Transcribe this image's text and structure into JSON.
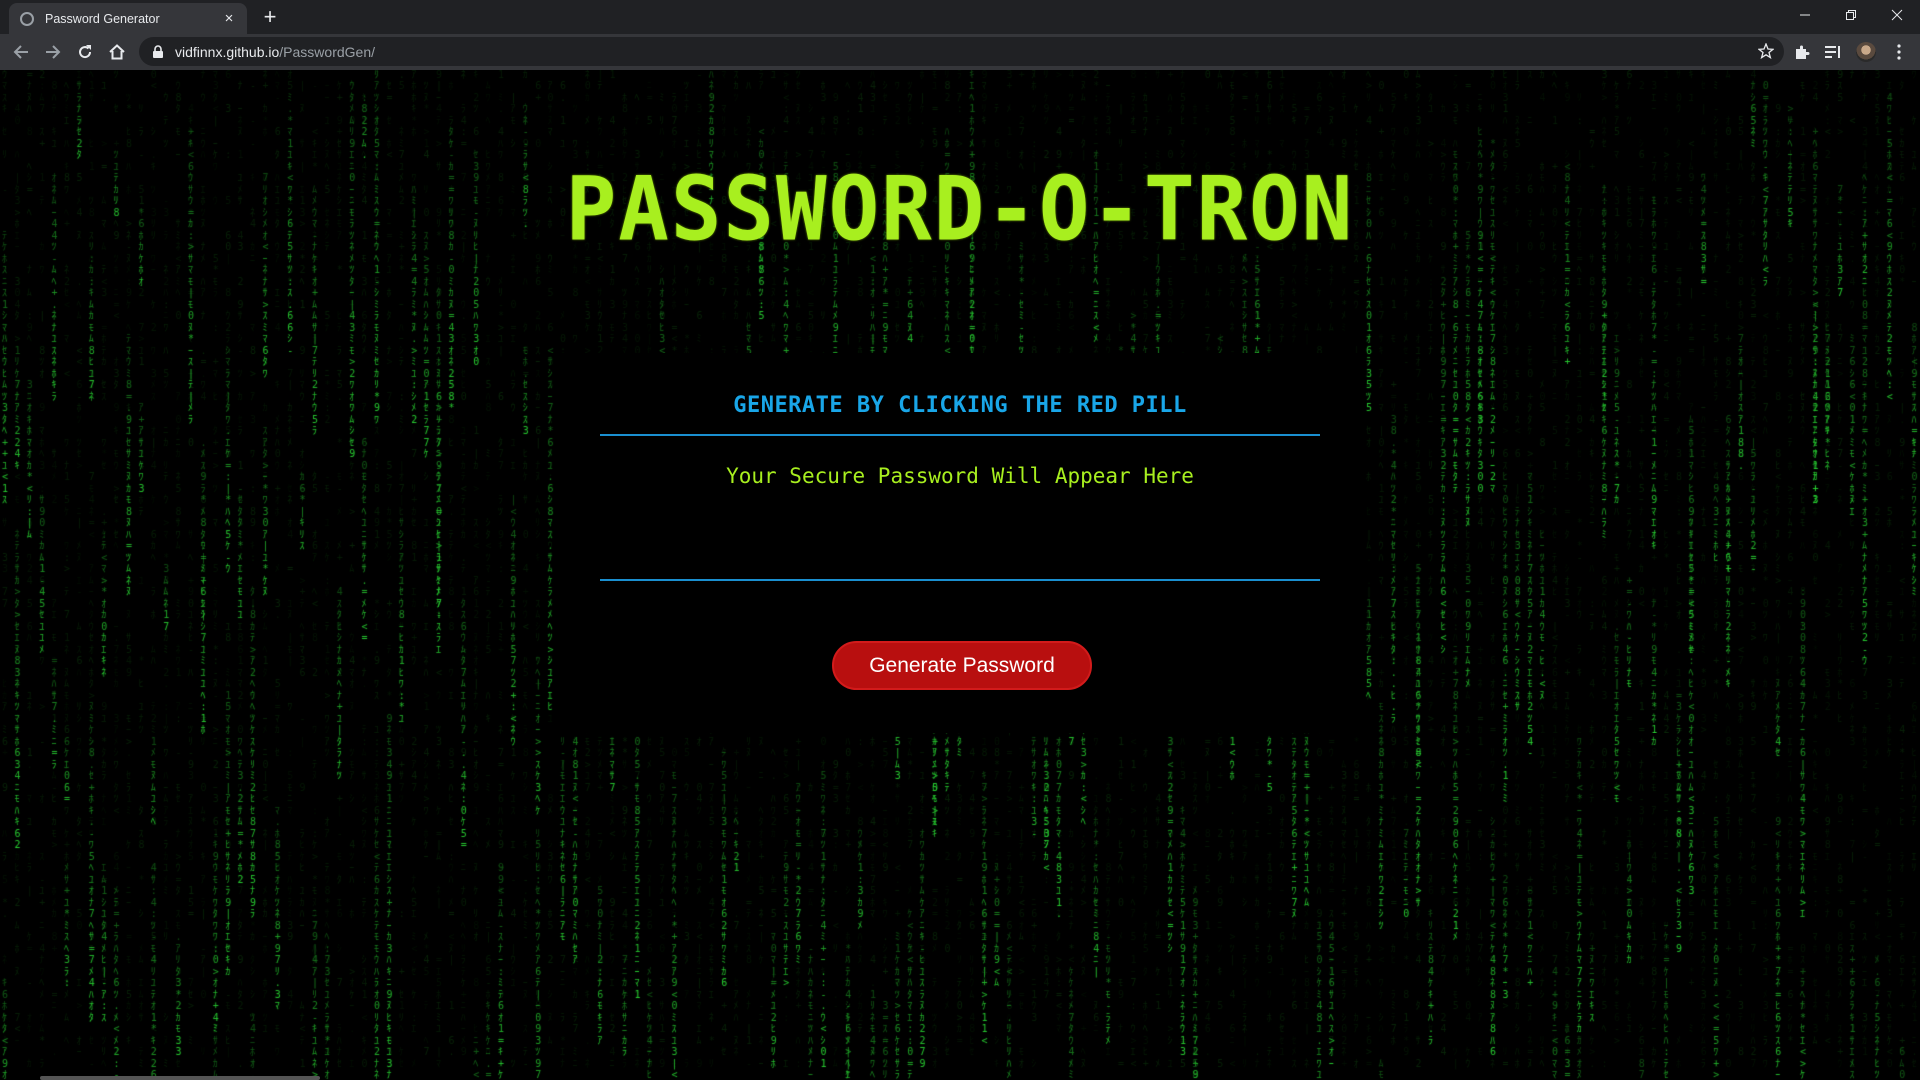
{
  "browser": {
    "tab_title": "Password Generator",
    "tab_close": "×",
    "new_tab": "+",
    "url_host": "vidfinnx.github.io",
    "url_path": "/PasswordGen/",
    "icons": [
      "back-icon",
      "forward-icon",
      "reload-icon",
      "home-icon",
      "lock-icon",
      "star-icon",
      "extensions-icon",
      "reading-list-icon",
      "avatar",
      "menu-icon",
      "minimize-icon",
      "restore-icon",
      "close-window-icon"
    ]
  },
  "page": {
    "title": "PASSWORD-O-TRON",
    "card_heading": "GENERATE BY CLICKING THE RED PILL",
    "password_placeholder": "Your Secure Password Will Appear Here",
    "generate_button": "Generate Password"
  },
  "colors": {
    "title": "#a8ef1f",
    "heading": "#19a6e8",
    "rule": "#1a8fd0",
    "button": "#b80f0f",
    "rain": "#1fbf2a",
    "background": "#000000"
  }
}
